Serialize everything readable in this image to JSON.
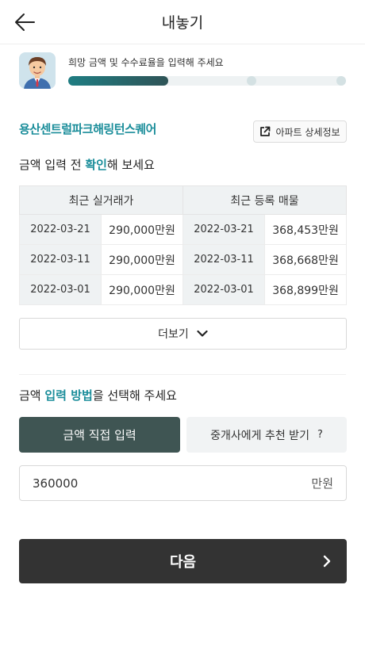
{
  "header": {
    "title": "내놓기",
    "back_icon": "arrow-left-icon"
  },
  "progress": {
    "label": "희망 금액 및 수수료율을 입력해 주세요",
    "fraction": 0.36,
    "steps": 3,
    "colors": {
      "fill_start": "#1f7d82",
      "fill_end": "#2f5457",
      "track": "#eef2f3"
    }
  },
  "apartment": {
    "name": "용산센트럴파크해링턴스퀘어",
    "detail_label": "아파트 상세정보",
    "detail_icon": "external-link-icon"
  },
  "check": {
    "prefix": "금액 입력 전 ",
    "highlight": "확인",
    "suffix": "해 보세요"
  },
  "table": {
    "headers": [
      "최근 실거래가",
      "최근 등록 매물"
    ],
    "rows": [
      {
        "deal_date": "2022-03-21",
        "deal_price": "290,000만원",
        "listing_date": "2022-03-21",
        "listing_price": "368,453만원"
      },
      {
        "deal_date": "2022-03-11",
        "deal_price": "290,000만원",
        "listing_date": "2022-03-11",
        "listing_price": "368,668만원"
      },
      {
        "deal_date": "2022-03-01",
        "deal_price": "290,000만원",
        "listing_date": "2022-03-01",
        "listing_price": "368,899만원"
      }
    ]
  },
  "more": {
    "label": "더보기",
    "icon": "chevron-down-icon"
  },
  "method": {
    "prefix": "금액 ",
    "highlight": "입력 방법",
    "suffix": "을 선택해 주세요",
    "direct_label": "금액 직접 입력",
    "agent_label": "중개사에게 추천 받기",
    "help_mark": "?"
  },
  "amount": {
    "value": "360000",
    "unit": "만원"
  },
  "next": {
    "label": "다음",
    "icon": "chevron-right-icon"
  },
  "colors": {
    "accent": "#1a8d9a",
    "selected_button": "#3f5553",
    "next_button": "#333333"
  }
}
